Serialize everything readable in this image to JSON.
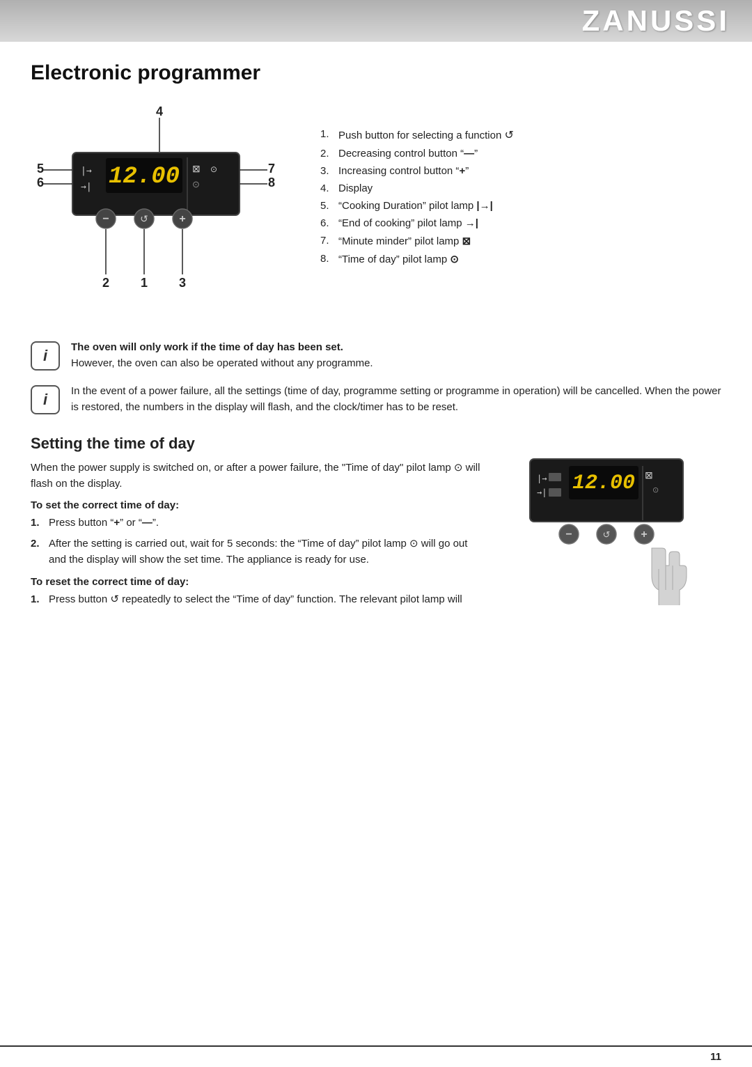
{
  "header": {
    "brand": "ZANUSSI"
  },
  "page": {
    "title": "Electronic  programmer",
    "footer_page_number": "11"
  },
  "diagram": {
    "labels": {
      "top": "4",
      "left_top": "5",
      "left_bottom": "6",
      "right_top": "7",
      "right_bottom": "8",
      "bottom_left": "2",
      "bottom_center": "1",
      "bottom_right": "3",
      "display_time": "12.00"
    }
  },
  "numbered_list": {
    "items": [
      {
        "num": "1.",
        "text": "Push button for selecting a function ",
        "symbol": "↺"
      },
      {
        "num": "2.",
        "text": "Decreasing control button \"",
        "symbol2": "—",
        "text2": "\""
      },
      {
        "num": "3.",
        "text": "Increasing control button \"",
        "symbol2": "+",
        "text2": "\""
      },
      {
        "num": "4.",
        "text": "Display"
      },
      {
        "num": "5.",
        "text": "\"Cooking Duration\" pilot lamp ",
        "symbol": "|→|"
      },
      {
        "num": "6.",
        "text": "\"End of cooking\" pilot lamp ",
        "symbol": "→|"
      },
      {
        "num": "7.",
        "text": "\"Minute minder\" pilot lamp ",
        "symbol": "⊠"
      },
      {
        "num": "8.",
        "text": "\"Time of day\" pilot lamp ",
        "symbol": "⊙"
      }
    ]
  },
  "info_boxes": [
    {
      "id": "info1",
      "bold_text": "The oven will only work if the time of day has been set.",
      "text": "However, the oven can also be operated without any programme."
    },
    {
      "id": "info2",
      "text": "In the event of a power failure, all the settings (time of day, programme setting or programme in operation) will be cancelled. When the power is restored, the numbers in the display will flash, and the clock/timer has to be reset."
    }
  ],
  "setting_section": {
    "title": "Setting the time of day",
    "intro": "When the power supply is switched on, or after a power failure, the \"Time of day\" pilot lamp ⊙ will flash on the display.",
    "subsection1_title": "To set the correct time of day:",
    "subsection1_steps": [
      {
        "num": "1.",
        "text": "Press button \"+\" or \"—\"."
      },
      {
        "num": "2.",
        "text": "After the setting is carried out, wait for 5 seconds: the \"Time of day\" pilot lamp ⊙ will go out and the display will show the set time. The appliance is ready for use."
      }
    ],
    "subsection2_title": "To reset the correct time of day:",
    "subsection2_steps": [
      {
        "num": "1.",
        "text": "Press button ↺ repeatedly to select the \"Time of day\" function. The relevant pilot lamp will"
      }
    ]
  }
}
